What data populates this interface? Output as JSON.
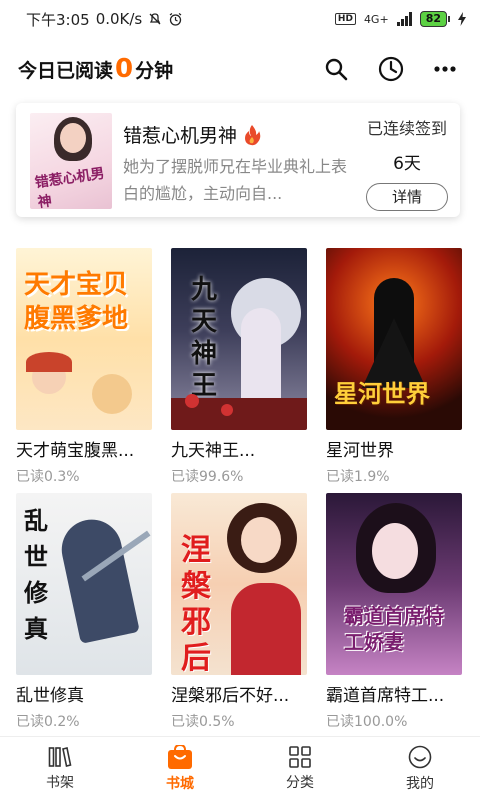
{
  "status_bar": {
    "time": "下午3:05",
    "network_speed": "0.0K/s",
    "hd": "HD",
    "net": "4G+",
    "battery": "82"
  },
  "header": {
    "reading_prefix": "今日已阅读",
    "reading_minutes": "0",
    "reading_suffix": "分钟",
    "icons": [
      "search-icon",
      "clock-icon",
      "more-icon"
    ]
  },
  "recent_book": {
    "title": "错惹心机男神",
    "cover_title": "错惹心机男神",
    "description": "她为了摆脱师兄在毕业典礼上表白的尴尬，主动向自...",
    "streak_label": "已连续签到",
    "streak_days": "6天",
    "details_button": "详情"
  },
  "books": [
    {
      "title": "天才萌宝腹黑爹地",
      "display": "天才萌宝腹黑...",
      "progress": "已读0.3%",
      "cover_text": "天才宝贝腹黑爹地"
    },
    {
      "title": "九天神王",
      "display": "九天神王...",
      "progress": "已读99.6%",
      "cover_text": "九天神王"
    },
    {
      "title": "星河世界",
      "display": "星河世界",
      "progress": "已读1.9%",
      "cover_text": "星河世界"
    },
    {
      "title": "乱世修真",
      "display": "乱世修真",
      "progress": "已读0.2%",
      "cover_text": "乱世修真"
    },
    {
      "title": "涅槃邪后不好惹",
      "display": "涅槃邪后不好...",
      "progress": "已读0.5%",
      "cover_text": "涅槃邪后"
    },
    {
      "title": "霸道首席特工娇妻",
      "display": "霸道首席特工...",
      "progress": "已读100.0%",
      "cover_text": "霸道首席特工娇妻"
    }
  ],
  "tabs": [
    {
      "label": "书架",
      "icon": "bookshelf-icon",
      "active": false
    },
    {
      "label": "书城",
      "icon": "store-bag-icon",
      "active": true
    },
    {
      "label": "分类",
      "icon": "category-grid-icon",
      "active": false
    },
    {
      "label": "我的",
      "icon": "profile-smile-icon",
      "active": false
    }
  ],
  "colors": {
    "accent": "#ff6a00",
    "muted": "#888888"
  }
}
